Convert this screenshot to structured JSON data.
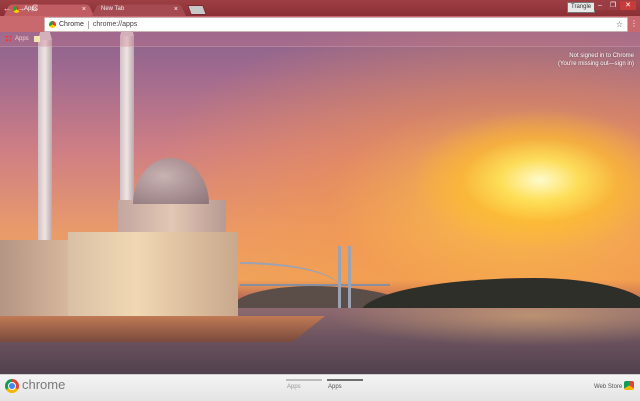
{
  "tabs": [
    {
      "label": "Apps",
      "active": true,
      "close": "×"
    },
    {
      "label": "New Tab",
      "active": false,
      "close": "×"
    }
  ],
  "window": {
    "profile_name": "Trangle",
    "minimize": "–",
    "maximize": "❐",
    "close": "✕"
  },
  "toolbar": {
    "back": "←",
    "forward": "→",
    "reload": "C",
    "omnibox_label": "Chrome",
    "omnibox_url": "chrome://apps",
    "star": "☆",
    "menu": "⋮"
  },
  "bookmarks": {
    "apps_label": "Apps"
  },
  "signin": {
    "line1": "Not signed in to Chrome",
    "line2": "(You're missing out—sign in)"
  },
  "bottom": {
    "brand": "chrome",
    "pages": [
      "Apps",
      "Apps"
    ],
    "webstore": "Web Store"
  },
  "colors": {
    "frame": "#9d3f43",
    "active_tab": "#bf5d63",
    "toolbar": "#c9696d"
  },
  "icons": [
    "chrome-logo-icon",
    "apps-grid-icon",
    "folder-icon",
    "star-icon",
    "menu-icon",
    "webstore-icon"
  ]
}
